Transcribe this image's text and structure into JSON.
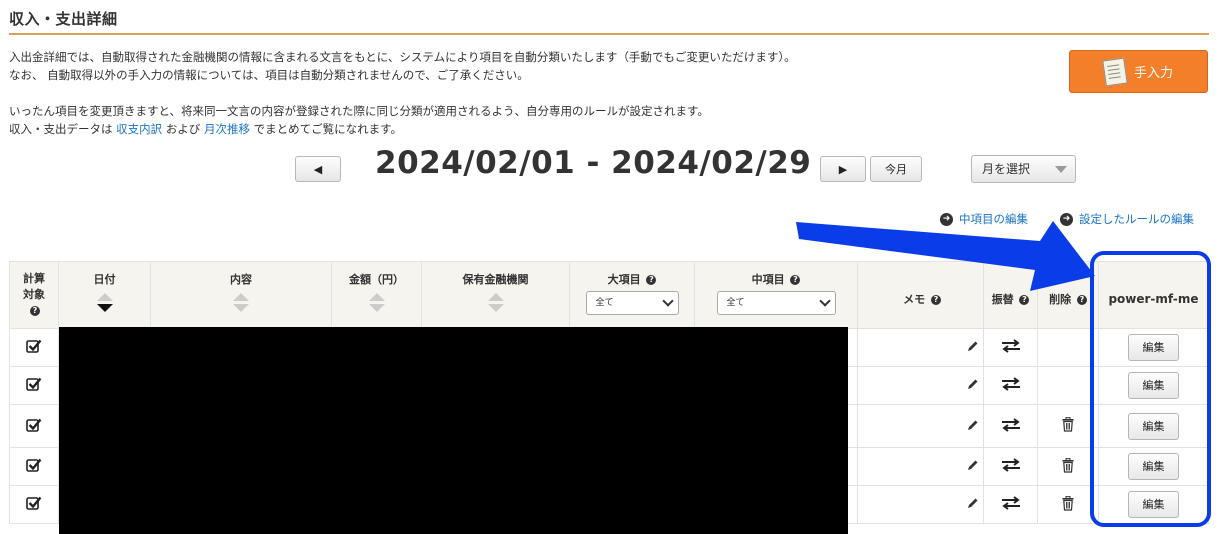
{
  "page": {
    "title": "収入・支出詳細",
    "desc_line1": "入出金詳細では、自動取得された金融機関の情報に含まれる文言をもとに、システムにより項目を自動分類いたします（手動でもご変更いただけます）。",
    "desc_line2": "なお、 自動取得以外の手入力の情報については、項目は自動分類されませんので、ご了承ください。",
    "desc_line3": "いったん項目を変更頂きますと、将来同一文言の内容が登録された際に同じ分類が適用されるよう、自分専用のルールが設定されます。",
    "desc_line4_pre": "収入・支出データは",
    "desc_link1": "収支内訳",
    "desc_line4_mid": "および",
    "desc_link2": "月次推移",
    "desc_line4_post": "でまとめてご覧になれます。"
  },
  "toolbar": {
    "manual_input": "手入力",
    "prev": "◀",
    "next": "▶",
    "today": "今月",
    "date_range": "2024/02/01 - 2024/02/29",
    "month_select": "月を選択",
    "edit_middle_items": "中項目の編集",
    "edit_rules": "設定したルールの編集"
  },
  "table": {
    "headers": {
      "calc_target": "計算対象",
      "date": "日付",
      "content": "内容",
      "amount": "金額（円）",
      "institution": "保有金融機関",
      "major": "大項目",
      "middle": "中項目",
      "memo": "メモ",
      "transfer": "振替",
      "delete": "削除",
      "extension": "power-mf-me"
    },
    "major_select": "全て",
    "middle_select": "全て",
    "question_mark": "?",
    "rows": [
      {
        "checked": true,
        "deletable": false,
        "edit": "編集"
      },
      {
        "checked": true,
        "deletable": false,
        "edit": "編集"
      },
      {
        "checked": true,
        "deletable": true,
        "edit": "編集"
      },
      {
        "checked": true,
        "deletable": true,
        "edit": "編集"
      },
      {
        "checked": true,
        "deletable": true,
        "edit": "編集"
      }
    ]
  },
  "annotation": {
    "arrow_color": "#0a3ce8",
    "highlight_color": "#0a3ce8"
  },
  "colors": {
    "accent_orange": "#f47f2a",
    "link_blue": "#1a74c6",
    "title_rule": "#d9a05c"
  }
}
